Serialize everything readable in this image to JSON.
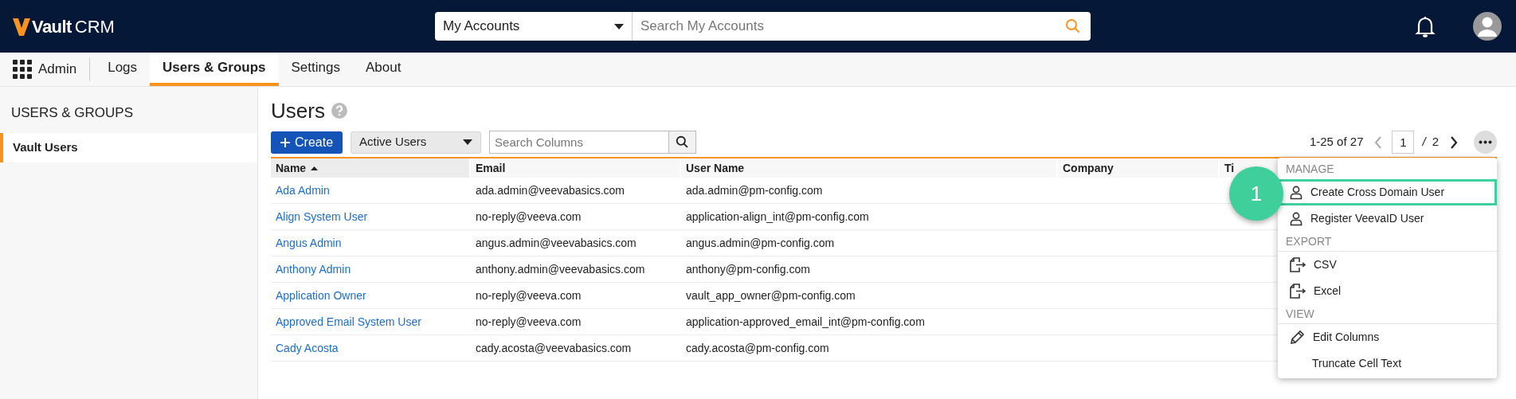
{
  "header": {
    "logo": {
      "brand": "Vault",
      "product": "CRM"
    },
    "search_scope": "My Accounts",
    "search": {
      "placeholder": "Search My Accounts"
    }
  },
  "nav": {
    "app": "Admin",
    "tabs": [
      {
        "label": "Logs",
        "selected": false
      },
      {
        "label": "Users & Groups",
        "selected": true
      },
      {
        "label": "Settings",
        "selected": false
      },
      {
        "label": "About",
        "selected": false
      }
    ]
  },
  "sidebar": {
    "heading": "USERS & GROUPS",
    "items": [
      {
        "label": "Vault Users",
        "selected": true
      }
    ]
  },
  "page": {
    "title": "Users",
    "create_button": "Create",
    "filter": "Active Users",
    "column_search": {
      "placeholder": "Search Columns"
    },
    "pager": {
      "range": "1-25 of 27",
      "page": "1",
      "separator": "/",
      "total": "2"
    }
  },
  "table": {
    "columns": [
      {
        "label": "Name",
        "sorted": true
      },
      {
        "label": "Email",
        "sorted": false
      },
      {
        "label": "User Name",
        "sorted": false
      },
      {
        "label": "Company",
        "sorted": false
      },
      {
        "label": "Ti",
        "sorted": false
      }
    ],
    "rows": [
      {
        "cells": [
          "Ada Admin",
          "ada.admin@veevabasics.com",
          "ada.admin@pm-config.com"
        ]
      },
      {
        "cells": [
          "Align System User",
          "no-reply@veeva.com",
          "application-align_int@pm-config.com"
        ]
      },
      {
        "cells": [
          "Angus Admin",
          "angus.admin@veevabasics.com",
          "angus.admin@pm-config.com"
        ]
      },
      {
        "cells": [
          "Anthony Admin",
          "anthony.admin@veevabasics.com",
          "anthony@pm-config.com"
        ]
      },
      {
        "cells": [
          "Application Owner",
          "no-reply@veeva.com",
          "vault_app_owner@pm-config.com"
        ]
      },
      {
        "cells": [
          "Approved Email System User",
          "no-reply@veeva.com",
          "application-approved_email_int@pm-config.com"
        ]
      },
      {
        "cells": [
          "Cady Acosta",
          "cady.acosta@veevabasics.com",
          "cady.acosta@pm-config.com"
        ]
      }
    ]
  },
  "menu": {
    "sections": [
      {
        "heading": "MANAGE",
        "items": [
          {
            "label": "Create Cross Domain User",
            "kind": "user",
            "highlighted": true
          },
          {
            "label": "Register VeevaID User",
            "kind": "user",
            "highlighted": false
          }
        ]
      },
      {
        "heading": "EXPORT",
        "items": [
          {
            "label": "CSV",
            "kind": "export",
            "highlighted": false
          },
          {
            "label": "Excel",
            "kind": "export",
            "highlighted": false
          }
        ]
      },
      {
        "heading": "VIEW",
        "items": [
          {
            "label": "Edit Columns",
            "kind": "edit",
            "highlighted": false
          },
          {
            "label": "Truncate Cell Text",
            "kind": "toggle",
            "highlighted": false
          }
        ]
      }
    ]
  },
  "callout": {
    "number": "1"
  }
}
